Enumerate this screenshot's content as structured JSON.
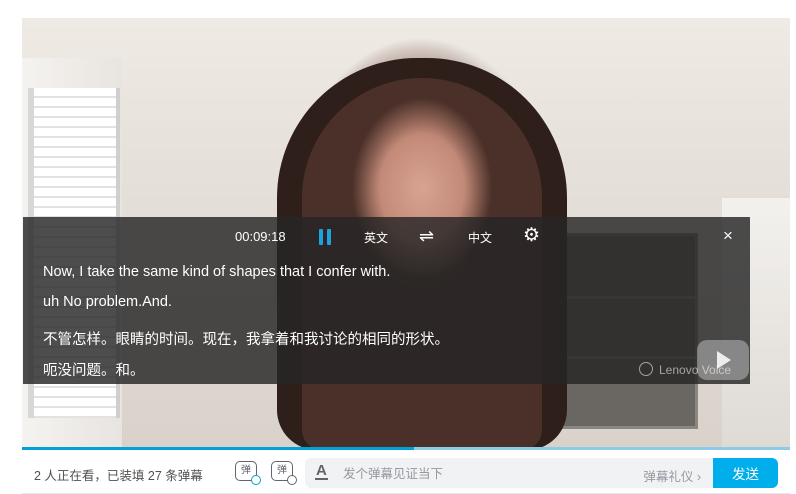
{
  "player": {
    "progress_fraction": 0.51
  },
  "subtitle_bar": {
    "time": "00:09:18",
    "source_lang": "英文",
    "swap_glyph": "⇌",
    "target_lang": "中文",
    "settings_glyph": "⚙",
    "close_glyph": "×",
    "lines": [
      "Now, I take the same kind of shapes that I confer with.",
      "uh No problem.And.",
      "不管怎样。眼睛的时间。现在，我拿着和我讨论的相同的形状。",
      "呃没问题。和。"
    ]
  },
  "watermark": {
    "text": "Lenovo Voice"
  },
  "danmaku_bar": {
    "viewers_text": "2 人正在看，已装填 27 条弹幕",
    "toggle_glyph": "弹",
    "settings_glyph": "弹",
    "font_glyph": "A",
    "input_placeholder": "发个弹幕见证当下",
    "etiquette_label": "弹幕礼仪 ›",
    "send_label": "发送"
  },
  "colors": {
    "accent": "#00aeec",
    "pause": "#1fa3e0",
    "overlay": "#262626"
  }
}
